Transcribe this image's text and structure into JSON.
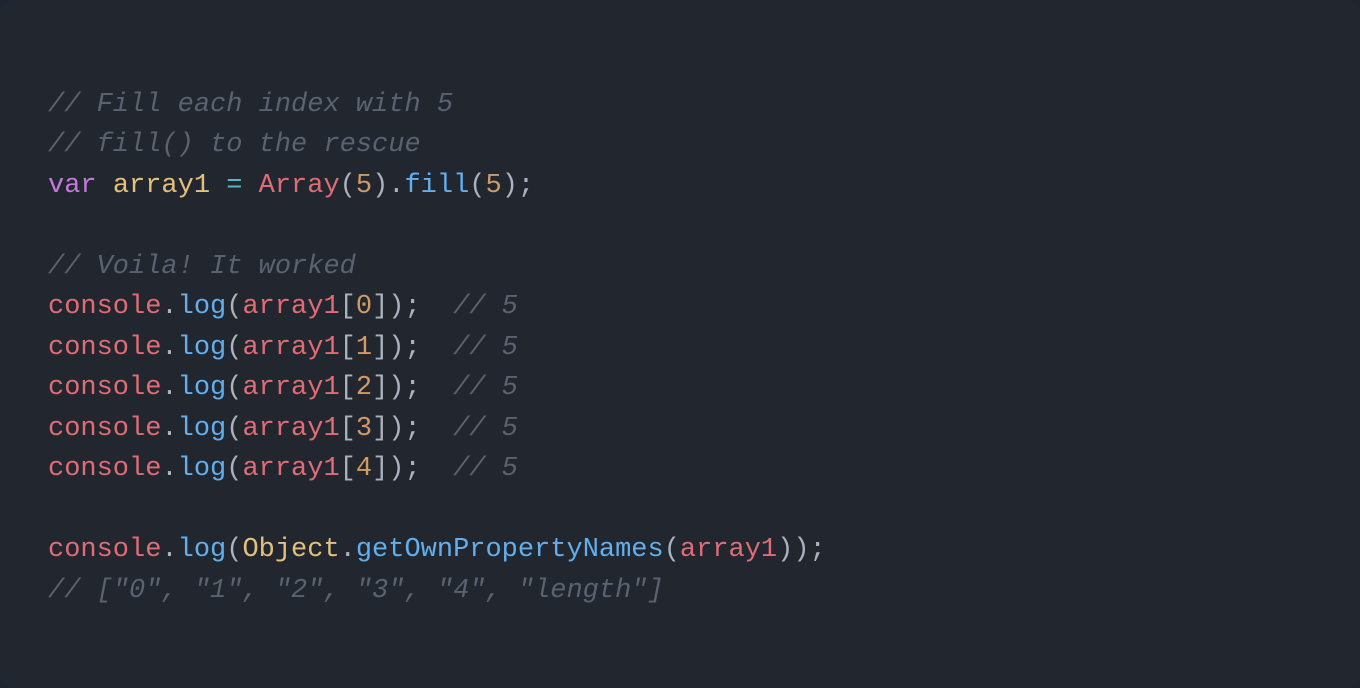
{
  "lines": {
    "c1": "// Fill each index with 5",
    "c2": "// fill() to the rescue",
    "l3_var": "var",
    "l3_name": "array1",
    "l3_eq": "=",
    "l3_ctor": "Array",
    "l3_arg1": "5",
    "l3_dot": ".",
    "l3_fill": "fill",
    "l3_arg2": "5",
    "c3": "// Voila! It worked",
    "console": "console",
    "log": "log",
    "arr": "array1",
    "idx0": "0",
    "idx1": "1",
    "idx2": "2",
    "idx3": "3",
    "idx4": "4",
    "r5": "// 5",
    "Object": "Object",
    "getOwn": "getOwnPropertyNames",
    "result": "// [\"0\", \"1\", \"2\", \"3\", \"4\", \"length\"]"
  }
}
